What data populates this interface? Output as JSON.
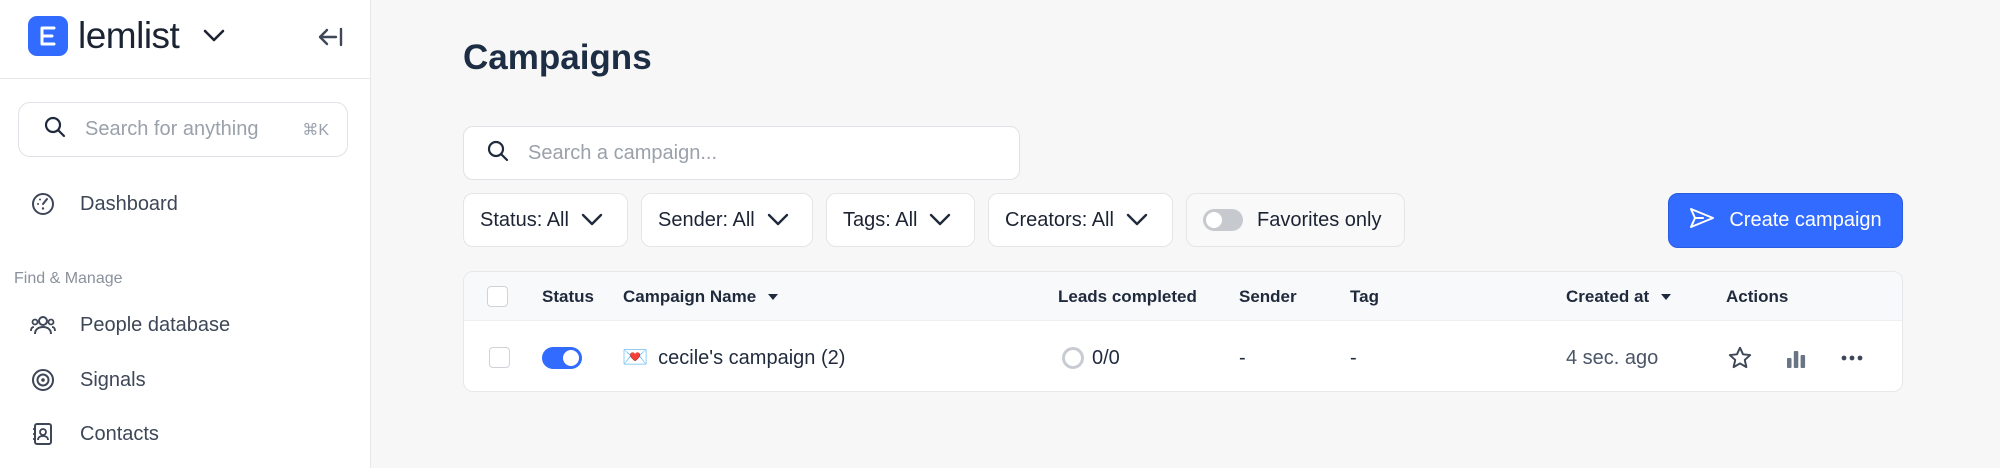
{
  "brand": {
    "name": "lemlist",
    "logo_letter": "E",
    "accent": "#316bff"
  },
  "sidebar": {
    "search_placeholder": "Search for anything",
    "search_shortcut": "⌘K",
    "dashboard_label": "Dashboard",
    "section_label": "Find & Manage",
    "items": [
      {
        "label": "People database",
        "icon": "people-icon"
      },
      {
        "label": "Signals",
        "icon": "target-icon"
      },
      {
        "label": "Contacts",
        "icon": "contacts-icon"
      }
    ]
  },
  "main": {
    "title": "Campaigns",
    "search_placeholder": "Search a campaign...",
    "filters": {
      "status": "Status: All",
      "sender": "Sender: All",
      "tags": "Tags: All",
      "creators": "Creators: All",
      "favorites": "Favorites only"
    },
    "create_label": "Create campaign"
  },
  "table": {
    "columns": {
      "status": "Status",
      "name": "Campaign Name",
      "leads": "Leads completed",
      "sender": "Sender",
      "tag": "Tag",
      "created": "Created at",
      "actions": "Actions"
    },
    "rows": [
      {
        "active": true,
        "emoji": "💌",
        "name": "cecile's campaign (2)",
        "leads": "0/0",
        "sender": "-",
        "tag": "-",
        "created": "4 sec. ago"
      }
    ]
  }
}
